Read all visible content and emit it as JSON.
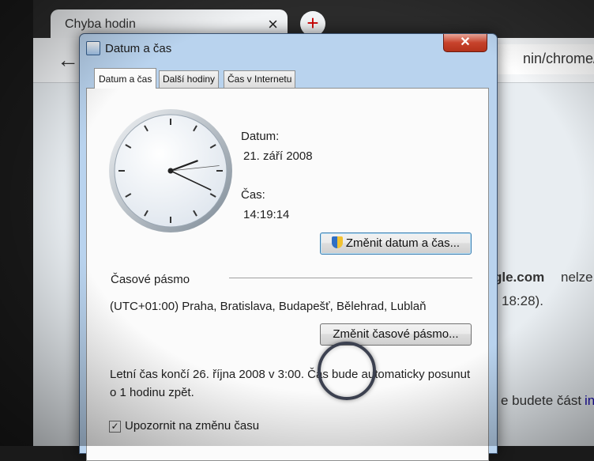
{
  "browser": {
    "tab": {
      "title": "Chyba hodin",
      "close_glyph": "×"
    },
    "new_tab_glyph": "+",
    "back_glyph": "←",
    "url": "nin/chrome/syn",
    "page_texts": [
      "gle.com",
      "nelze",
      "18:28).",
      "e budete část",
      "in"
    ]
  },
  "dialog": {
    "title": "Datum a čas",
    "close_glyph": "✕",
    "tabs": [
      "Datum a čas",
      "Další hodiny",
      "Čas v Internetu"
    ],
    "date_label": "Datum:",
    "date_value": "21. září 2008",
    "time_label": "Čas:",
    "time_value": "14:19:14",
    "change_datetime_button": "Změnit datum a čas...",
    "timezone_label": "Časové pásmo",
    "timezone_value": "(UTC+01:00) Praha, Bratislava, Budapešť, Bělehrad, Lublaň",
    "change_timezone_button": "Změnit časové pásmo...",
    "dst_line1": "Letní čas končí 26. října 2008 v 3:00. Čas bude automaticky posunut",
    "dst_line2": "o 1 hodinu zpět.",
    "notify_checkbox_label": "Upozornit na změnu času",
    "notify_checked": true,
    "clock": {
      "hours": 14,
      "minutes": 19,
      "seconds": 14
    }
  }
}
